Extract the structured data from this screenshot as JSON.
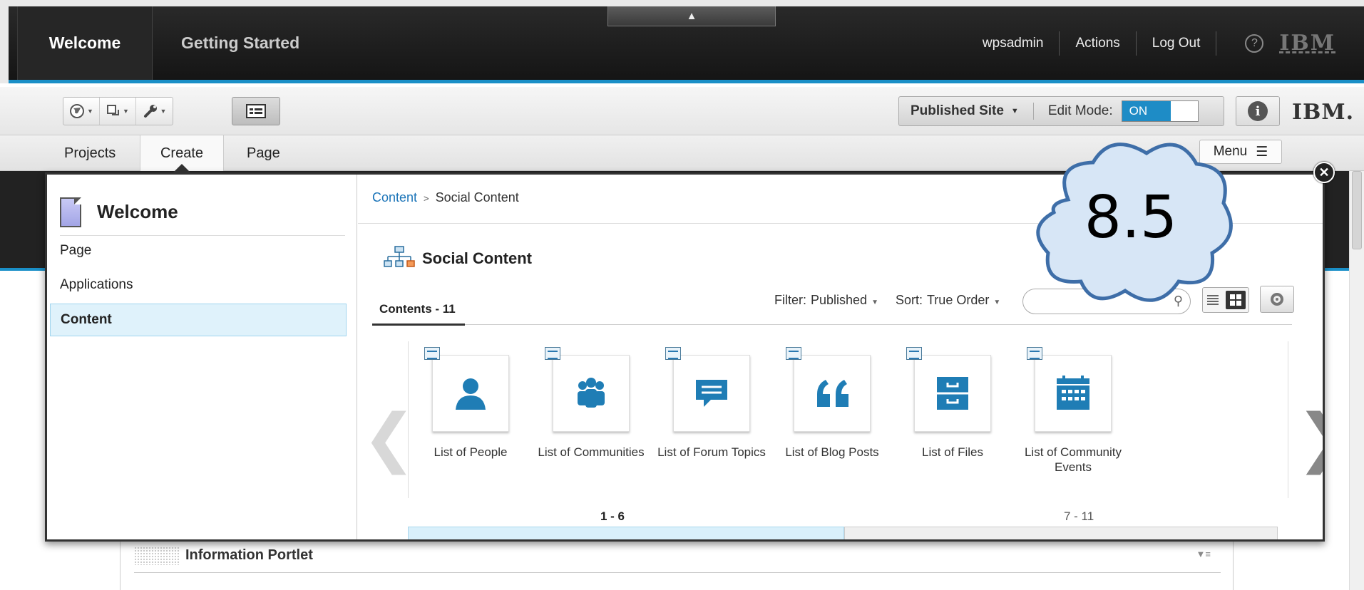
{
  "header": {
    "tabs": [
      {
        "label": "Welcome"
      },
      {
        "label": "Getting Started"
      }
    ],
    "user": "wpsadmin",
    "actions": "Actions",
    "logout": "Log Out",
    "help": "?",
    "brand": "IBM"
  },
  "toolbar": {
    "published_site": "Published Site",
    "edit_mode_label": "Edit Mode:",
    "edit_mode_value": "ON",
    "brand": "IBM."
  },
  "nav": {
    "tabs": [
      {
        "label": "Projects"
      },
      {
        "label": "Create"
      },
      {
        "label": "Page"
      }
    ],
    "menu": "Menu"
  },
  "flyout": {
    "title": "Welcome",
    "left_items": [
      {
        "label": "Page"
      },
      {
        "label": "Applications"
      },
      {
        "label": "Content"
      }
    ],
    "breadcrumb": {
      "root": "Content",
      "separator": ">",
      "current": "Social Content"
    },
    "section_title": "Social Content",
    "contents_tab": "Contents - 11",
    "filter_label": "Filter:",
    "filter_value": "Published",
    "sort_label": "Sort:",
    "sort_value": "True Order",
    "items": [
      {
        "label": "List of People",
        "icon": "person-icon"
      },
      {
        "label": "List of Communities",
        "icon": "community-icon"
      },
      {
        "label": "List of Forum Topics",
        "icon": "forum-icon"
      },
      {
        "label": "List of Blog Posts",
        "icon": "quote-icon"
      },
      {
        "label": "List of Files",
        "icon": "file-cabinet-icon"
      },
      {
        "label": "List of Community Events",
        "icon": "calendar-icon"
      }
    ],
    "pages": [
      "1 - 6",
      "7 - 11"
    ]
  },
  "portlet": {
    "title": "Information Portlet"
  },
  "annotation": {
    "version": "8.5"
  },
  "colors": {
    "accent": "#1a8fc7",
    "icon_blue": "#1f7db5",
    "active_item_bg": "#dff2fb"
  }
}
